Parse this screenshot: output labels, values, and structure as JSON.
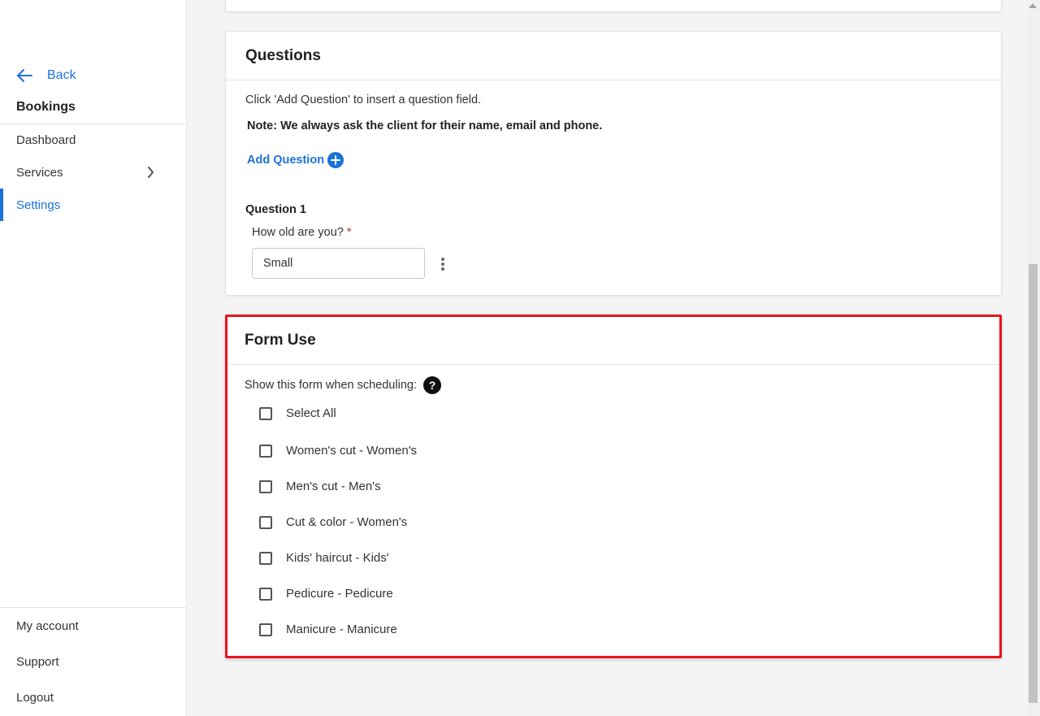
{
  "sidebar": {
    "back_label": "Back",
    "section_title": "Bookings",
    "nav": [
      {
        "label": "Dashboard"
      },
      {
        "label": "Services"
      },
      {
        "label": "Settings"
      }
    ],
    "footer": [
      {
        "label": "My account"
      },
      {
        "label": "Support"
      },
      {
        "label": "Logout"
      }
    ]
  },
  "questions": {
    "title": "Questions",
    "intro": "Click 'Add Question' to insert a question field.",
    "note": "Note: We always ask the client for their name, email and phone.",
    "add_label": "Add Question",
    "question_title": "Question 1",
    "question_label": "How old are you?",
    "required_mark": "*",
    "answer_value": "Small"
  },
  "form_use": {
    "title": "Form Use",
    "show_label": "Show this form when scheduling:",
    "help_glyph": "?",
    "options": [
      {
        "label": "Select All",
        "checked": false
      },
      {
        "label": "Women's cut - Women's",
        "checked": false
      },
      {
        "label": "Men's cut - Men's",
        "checked": false
      },
      {
        "label": "Cut & color - Women's",
        "checked": false
      },
      {
        "label": "Kids' haircut - Kids'",
        "checked": false
      },
      {
        "label": "Pedicure - Pedicure",
        "checked": false
      },
      {
        "label": "Manicure - Manicure",
        "checked": false
      }
    ]
  },
  "colors": {
    "accent": "#1a73d9",
    "highlight_border": "#e8141d",
    "required": "#d12c2c"
  }
}
